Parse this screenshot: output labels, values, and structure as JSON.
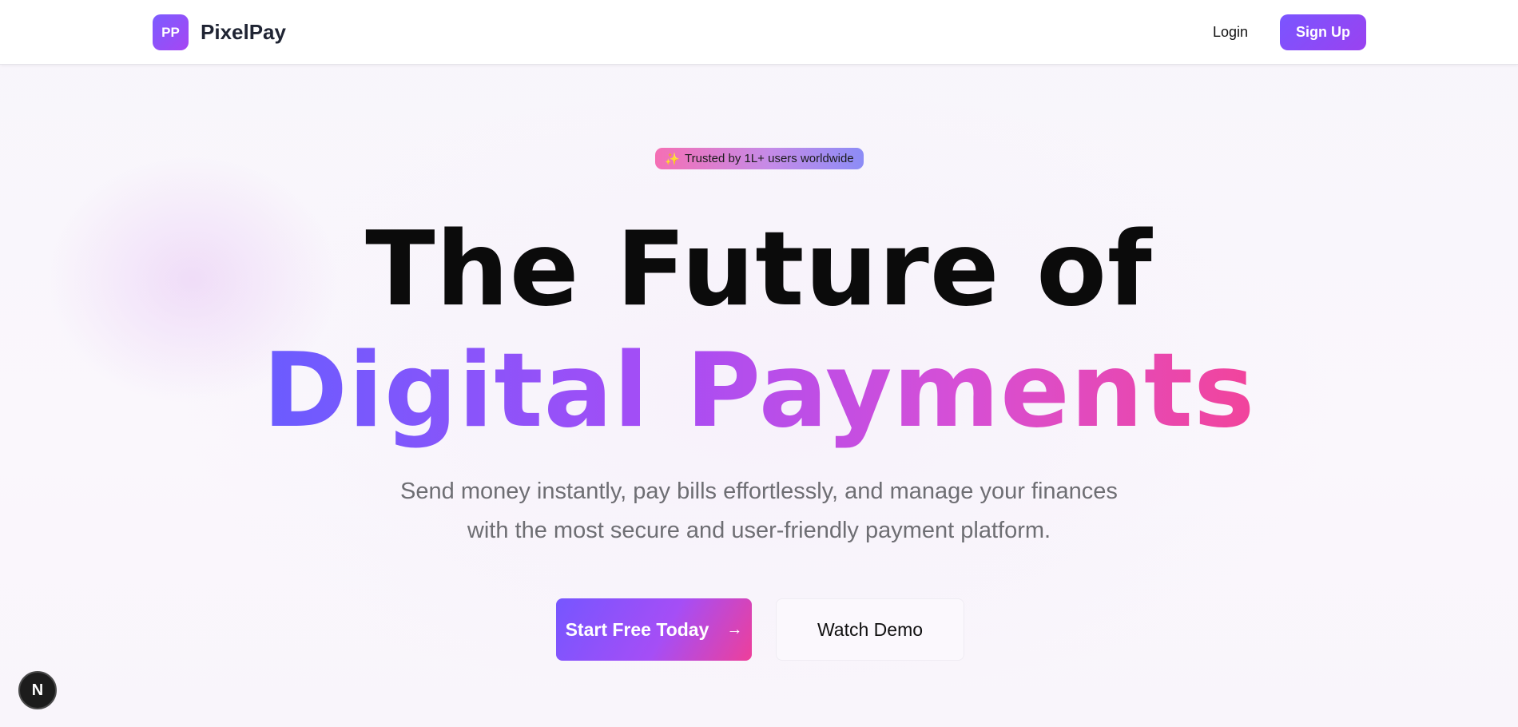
{
  "header": {
    "logo_text": "PP",
    "brand_name": "PixelPay",
    "login_label": "Login",
    "signup_label": "Sign Up"
  },
  "hero": {
    "badge_text": "Trusted by 1L+ users worldwide",
    "badge_icon": "sparkle-icon",
    "title_line1": "The Future of",
    "title_line2": "Digital Payments",
    "subtitle_line1": "Send money instantly, pay bills effortlessly, and manage your finances",
    "subtitle_line2": "with the most secure and user-friendly payment platform.",
    "primary_cta": "Start Free Today",
    "secondary_cta": "Watch Demo"
  },
  "dev_badge": {
    "label": "N"
  },
  "colors": {
    "accent_purple": "#7a55ff",
    "accent_pink": "#ee3f9a",
    "title_dark": "#0b0b0b",
    "subtitle_gray": "#6e6e73"
  }
}
